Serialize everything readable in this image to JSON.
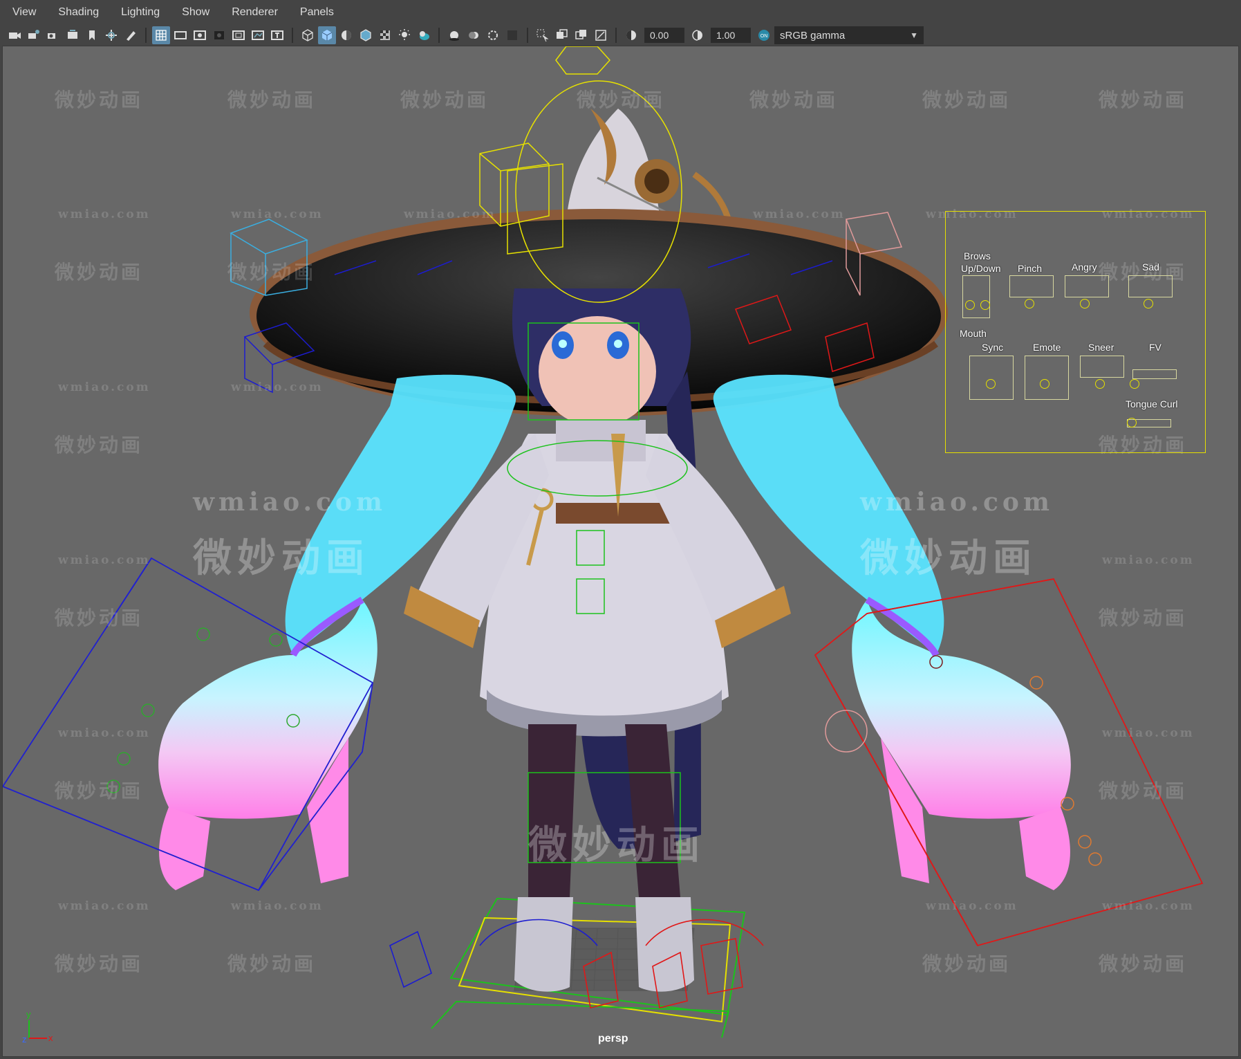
{
  "menubar": {
    "items": [
      "View",
      "Shading",
      "Lighting",
      "Show",
      "Renderer",
      "Panels"
    ]
  },
  "toolbar": {
    "exposure_value": "0.00",
    "gamma_value": "1.00",
    "color_space": "sRGB gamma",
    "icons": [
      "camera-icon",
      "camera-attributes-icon",
      "bookmark-camera-icon",
      "image-plane-icon",
      "grease-pencil-icon",
      "grid-icon",
      "film-gate-icon",
      "resolution-gate-icon",
      "gate-mask-icon",
      "field-chart-icon",
      "safe-action-icon",
      "safe-title-icon",
      "wireframe-icon",
      "smooth-shade-icon",
      "default-material-icon",
      "wireframe-on-shaded-icon",
      "xray-icon",
      "use-lights-icon",
      "shadows-icon",
      "screen-space-ao-icon",
      "motion-blur-icon",
      "anti-aliasing-icon",
      "depth-of-field-icon",
      "isolate-select-icon",
      "xray-joints-icon",
      "xray-active-icon",
      "backface-culling-icon",
      "exposure-icon",
      "gamma-icon",
      "color-management-icon"
    ],
    "accent": "#5a88a8"
  },
  "viewport": {
    "camera_label": "persp",
    "background": "#686868",
    "watermark_cn": "微妙动画",
    "watermark_en": "wmiao.com",
    "axis": {
      "y": "y",
      "z": "z",
      "x": "x"
    }
  },
  "face_controls": {
    "labels": {
      "brows": "Brows",
      "updown": "Up/Down",
      "pinch": "Pinch",
      "angry": "Angry",
      "sad": "Sad",
      "mouth": "Mouth",
      "sync": "Sync",
      "emote": "Emote",
      "sneer": "Sneer",
      "fv": "FV",
      "tongue": "Tongue Curl"
    },
    "color": "#e6e000"
  }
}
